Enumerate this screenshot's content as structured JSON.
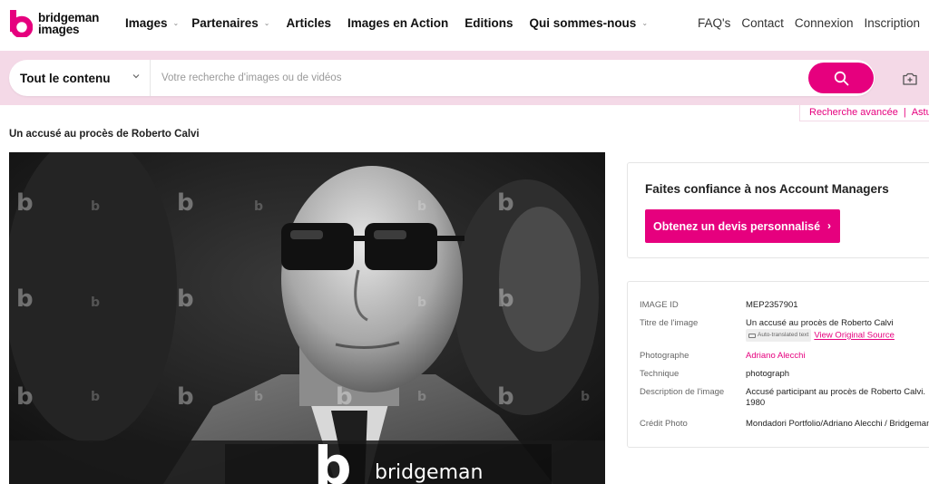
{
  "brand": {
    "line1": "bridgeman",
    "line2": "images",
    "accent": "#e6007e",
    "band": "#f4d9e7"
  },
  "nav": [
    {
      "label": "Images",
      "dropdown": true
    },
    {
      "label": "Partenaires",
      "dropdown": true
    },
    {
      "label": "Articles",
      "dropdown": false
    },
    {
      "label": "Images en Action",
      "dropdown": false
    },
    {
      "label": "Editions",
      "dropdown": false
    },
    {
      "label": "Qui sommes-nous",
      "dropdown": true
    }
  ],
  "right_links": [
    "FAQ's",
    "Contact",
    "Connexion",
    "Inscription"
  ],
  "search": {
    "scope": "Tout le contenu",
    "placeholder": "Votre recherche d'images ou de vidéos",
    "search_icon": "search-icon",
    "camera_icon": "camera-add-icon"
  },
  "subbar": {
    "advanced": "Recherche avancée",
    "separator": "|",
    "help": "Astuce"
  },
  "page_title": "Un accusé au procès de Roberto Calvi",
  "photo": {
    "watermark_text": "bridgeman",
    "watermark_letter": "b"
  },
  "devis": {
    "heading": "Faites confiance à nos Account Managers",
    "button": "Obtenez un devis personnalisé",
    "arrow": "›"
  },
  "details": {
    "image_id": {
      "key": "IMAGE ID",
      "value": "MEP2357901"
    },
    "title": {
      "key": "Titre de l'image",
      "value": "Un accusé au procès de Roberto Calvi",
      "auto_tag": "Auto-translated text",
      "orig_link": "View Original Source"
    },
    "photographer": {
      "key": "Photographe",
      "value": "Adriano Alecchi"
    },
    "technique": {
      "key": "Technique",
      "value": "photograph"
    },
    "description": {
      "key": "Description de l'image",
      "value": "Accusé participant au procès de Roberto Calvi. 1980"
    },
    "credit": {
      "key": "Crédit Photo",
      "value": "Mondadori Portfolio/Adriano Alecchi / Bridgeman"
    }
  }
}
